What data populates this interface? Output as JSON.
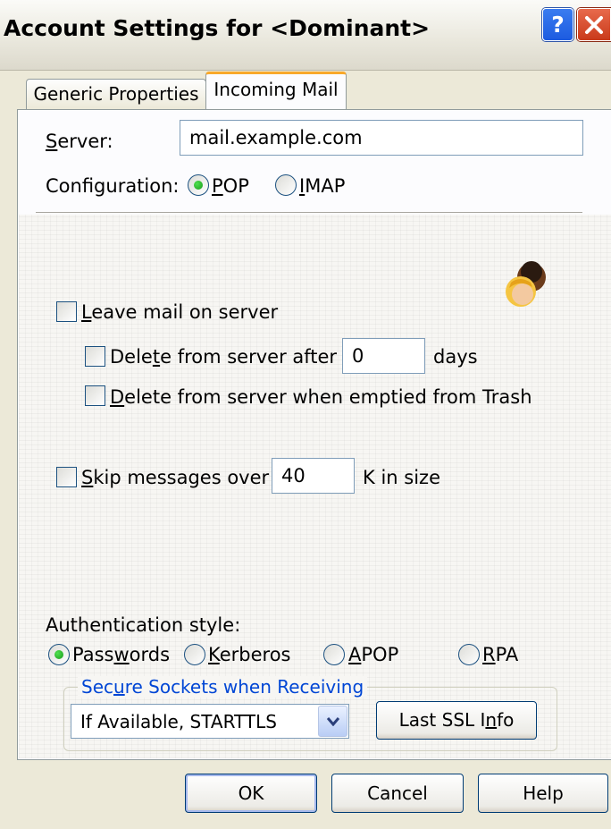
{
  "window": {
    "title": "Account Settings for <Dominant>",
    "help_glyph": "?"
  },
  "tabs": [
    {
      "label": "Generic Properties",
      "active": false
    },
    {
      "label": "Incoming Mail",
      "active": true
    }
  ],
  "server": {
    "label_hotkey": "S",
    "label_rest": "erver:",
    "value": "mail.example.com"
  },
  "configuration": {
    "label": "Configuration:",
    "options": [
      {
        "hotkey": "P",
        "rest": "OP",
        "selected": true
      },
      {
        "hotkey": "I",
        "rest": "MAP",
        "selected": false
      }
    ]
  },
  "leave_mail": {
    "hotkey": "L",
    "rest": "eave mail on server",
    "checked": false
  },
  "delete_after": {
    "pre": "Dele",
    "hotkey": "t",
    "rest": "e from server after",
    "value": "0",
    "suffix": "days",
    "checked": false
  },
  "delete_trash": {
    "hotkey": "D",
    "rest": "elete from server when emptied from Trash",
    "checked": false
  },
  "skip_messages": {
    "hotkey": "S",
    "rest": "kip messages over",
    "value": "40",
    "suffix": "K in size",
    "checked": false
  },
  "authentication": {
    "label": "Authentication style:",
    "options": [
      {
        "pre": "Pass",
        "hotkey": "w",
        "rest": "ords",
        "selected": true
      },
      {
        "pre": "",
        "hotkey": "K",
        "rest": "erberos",
        "selected": false
      },
      {
        "pre": "",
        "hotkey": "A",
        "rest": "POP",
        "selected": false
      },
      {
        "pre": "",
        "hotkey": "R",
        "rest": "PA",
        "selected": false
      }
    ]
  },
  "ssl": {
    "group_pre": "Sec",
    "group_hotkey": "u",
    "group_rest": "re Sockets when Receiving",
    "selected": "If Available, STARTTLS",
    "info_pre": "Last SSL I",
    "info_hotkey": "n",
    "info_rest": "fo"
  },
  "buttons": {
    "ok": "OK",
    "cancel": "Cancel",
    "help": "Help"
  },
  "icons": {
    "users": "users-icon"
  },
  "colors": {
    "accent_blue": "#0046d5",
    "tab_highlight": "#f8a82a",
    "radio_green": "#1a9b1a"
  }
}
